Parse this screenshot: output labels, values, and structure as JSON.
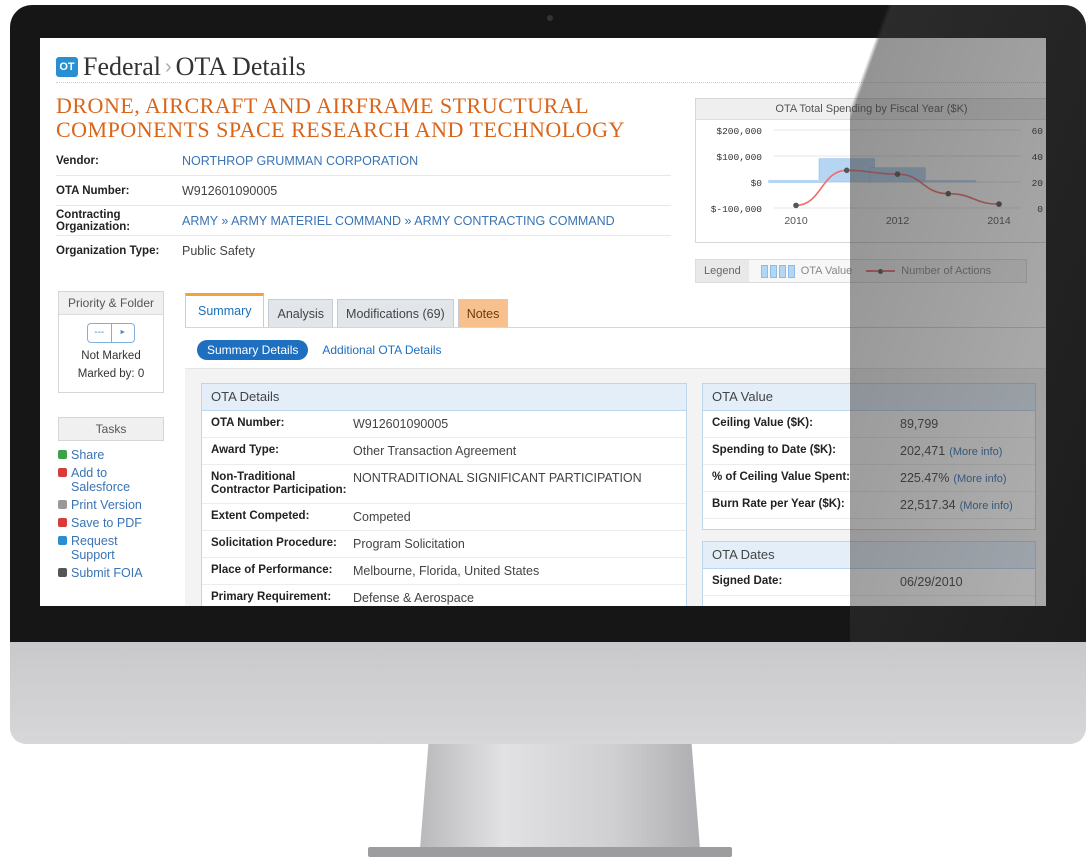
{
  "header": {
    "logo": "OT",
    "section": "Federal",
    "separator": "›",
    "page": "OTA Details"
  },
  "title": "DRONE, AIRCRAFT AND AIRFRAME STRUCTURAL COMPONENTS SPACE RESEARCH AND TECHNOLOGY",
  "info": {
    "vendor_label": "Vendor:",
    "vendor_value": "NORTHROP GRUMMAN CORPORATION",
    "ota_label": "OTA Number:",
    "ota_value": "W912601090005",
    "contracting_label": "Contracting Organization:",
    "contracting_value": "ARMY » ARMY MATERIEL COMMAND » ARMY CONTRACTING COMMAND",
    "orgtype_label": "Organization Type:",
    "orgtype_value": "Public Safety"
  },
  "chart_data": {
    "type": "bar",
    "title": "OTA Total Spending by Fiscal Year ($K)",
    "categories": [
      "2010",
      "2011",
      "2012",
      "2013",
      "2014"
    ],
    "x_tick_labels": [
      "2010",
      "2012",
      "2014"
    ],
    "y_left_ticks": [
      "$200,000",
      "$100,000",
      "$0",
      "$-100,000"
    ],
    "y_right_ticks": [
      "60",
      "40",
      "20",
      "0"
    ],
    "ylim": [
      -100000,
      200000
    ],
    "y2lim": [
      0,
      60
    ],
    "series": [
      {
        "name": "OTA Value",
        "type": "bar",
        "values": [
          0,
          90000,
          55000,
          5000,
          0
        ]
      },
      {
        "name": "Number of Actions",
        "type": "line",
        "axis": "right",
        "values": [
          2,
          29,
          26,
          11,
          3
        ]
      }
    ],
    "legend_label": "Legend",
    "colors": {
      "bars": "#b5d5f3",
      "line": "#f26b6b",
      "points": "#555555"
    }
  },
  "sidebar": {
    "priority_title": "Priority & Folder",
    "toggle_left": "---",
    "toggle_right": "►",
    "not_marked": "Not Marked",
    "marked_by": "Marked by: 0",
    "tasks_title": "Tasks",
    "tasks": [
      {
        "label": "Share",
        "icon": "share-icon",
        "color": "#3aa34a"
      },
      {
        "label": "Add to Salesforce",
        "icon": "salesforce-icon",
        "color": "#d93a3a"
      },
      {
        "label": "Print Version",
        "icon": "print-icon",
        "color": "#888888"
      },
      {
        "label": "Save to PDF",
        "icon": "pdf-icon",
        "color": "#d93a3a"
      },
      {
        "label": "Request Support",
        "icon": "support-icon",
        "color": "#2a8fd0"
      },
      {
        "label": "Submit FOIA",
        "icon": "foia-icon",
        "color": "#555555"
      }
    ]
  },
  "tabs": {
    "summary": "Summary",
    "analysis": "Analysis",
    "modifications": "Modifications (69)",
    "notes": "Notes"
  },
  "subtabs": {
    "active": "Summary Details",
    "other": "Additional OTA Details"
  },
  "ota_details": {
    "title": "OTA Details",
    "rows": [
      {
        "label": "OTA Number:",
        "value": "W912601090005"
      },
      {
        "label": "Award Type:",
        "value": "Other Transaction Agreement"
      },
      {
        "label": "Non-Traditional Contractor Participation:",
        "value": "NONTRADITIONAL SIGNIFICANT PARTICIPATION"
      },
      {
        "label": "Extent Competed:",
        "value": "Competed"
      },
      {
        "label": "Solicitation Procedure:",
        "value": "Program Solicitation"
      },
      {
        "label": "Place of Performance:",
        "value": "Melbourne, Florida, United States"
      },
      {
        "label": "Primary Requirement:",
        "value": "Defense & Aerospace"
      }
    ]
  },
  "ota_value": {
    "title": "OTA Value",
    "more": "(More info)",
    "rows": [
      {
        "label": "Ceiling Value ($K):",
        "value": "89,799"
      },
      {
        "label": "Spending to Date ($K):",
        "value": "202,471"
      },
      {
        "label": "% of Ceiling Value Spent:",
        "value": "225.47%"
      },
      {
        "label": "Burn Rate per Year ($K):",
        "value": "22,517.34"
      }
    ]
  },
  "ota_dates": {
    "title": "OTA Dates",
    "rows": [
      {
        "label": "Signed Date:",
        "value": "06/29/2010"
      }
    ]
  }
}
